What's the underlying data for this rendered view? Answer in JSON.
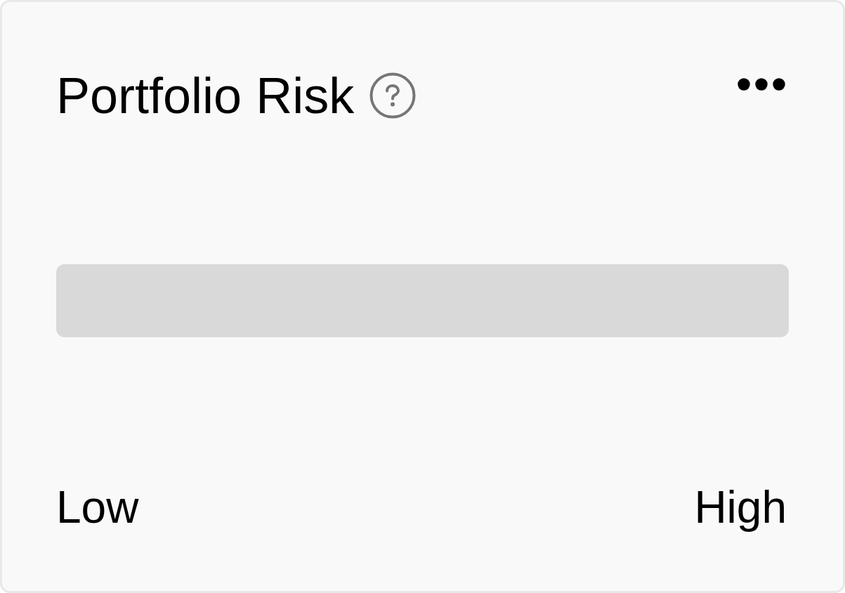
{
  "card": {
    "title": "Portfolio Risk"
  },
  "risk_meter": {
    "min_label": "Low",
    "max_label": "High"
  }
}
